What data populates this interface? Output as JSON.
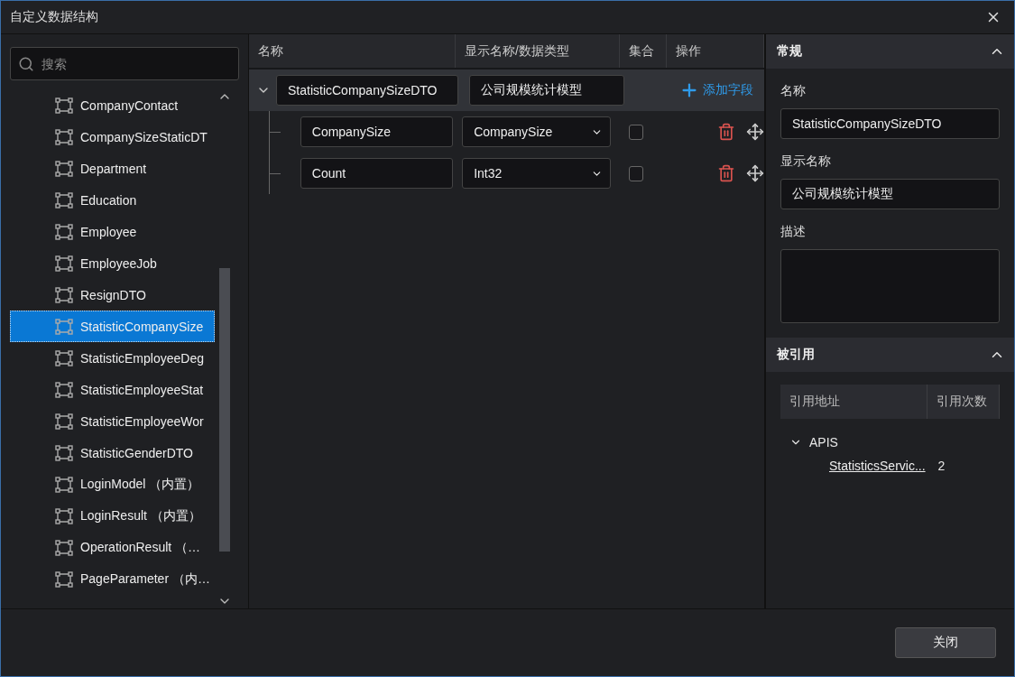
{
  "window": {
    "title": "自定义数据结构"
  },
  "sidebar": {
    "search": {
      "placeholder": "搜索"
    },
    "items": [
      {
        "label": "CompanyContact",
        "selected": false
      },
      {
        "label": "CompanySizeStaticDT",
        "selected": false
      },
      {
        "label": "Department",
        "selected": false
      },
      {
        "label": "Education",
        "selected": false
      },
      {
        "label": "Employee",
        "selected": false
      },
      {
        "label": "EmployeeJob",
        "selected": false
      },
      {
        "label": "ResignDTO",
        "selected": false
      },
      {
        "label": "StatisticCompanySize",
        "selected": true
      },
      {
        "label": "StatisticEmployeeDeg",
        "selected": false
      },
      {
        "label": "StatisticEmployeeStat",
        "selected": false
      },
      {
        "label": "StatisticEmployeeWor",
        "selected": false
      },
      {
        "label": "StatisticGenderDTO",
        "selected": false
      },
      {
        "label": "LoginModel （内置）",
        "selected": false
      },
      {
        "label": "LoginResult （内置）",
        "selected": false
      },
      {
        "label": "OperationResult （…",
        "selected": false
      },
      {
        "label": "PageParameter （内…",
        "selected": false
      }
    ]
  },
  "table": {
    "columns": [
      "名称",
      "显示名称/数据类型",
      "集合",
      "操作"
    ],
    "root": {
      "name": "StatisticCompanySizeDTO",
      "display_name": "公司规模统计模型",
      "expanded": true,
      "add_label": "添加字段"
    },
    "rows": [
      {
        "name": "CompanySize",
        "type": "CompanySize",
        "collection": false
      },
      {
        "name": "Count",
        "type": "Int32",
        "collection": false
      }
    ]
  },
  "properties": {
    "general": {
      "title": "常规",
      "expanded": true,
      "name_label": "名称",
      "name": "StatisticCompanySizeDTO",
      "display_label": "显示名称",
      "display_name": "公司规模统计模型",
      "description_label": "描述"
    },
    "references": {
      "title": "被引用",
      "expanded": true,
      "columns": [
        "引用地址",
        "引用次数"
      ],
      "groups": [
        {
          "label": "APIS",
          "expanded": true,
          "children": [
            {
              "address": "StatisticsServic...",
              "count": "2"
            }
          ]
        }
      ]
    }
  },
  "footer": {
    "close_button": "关闭"
  }
}
